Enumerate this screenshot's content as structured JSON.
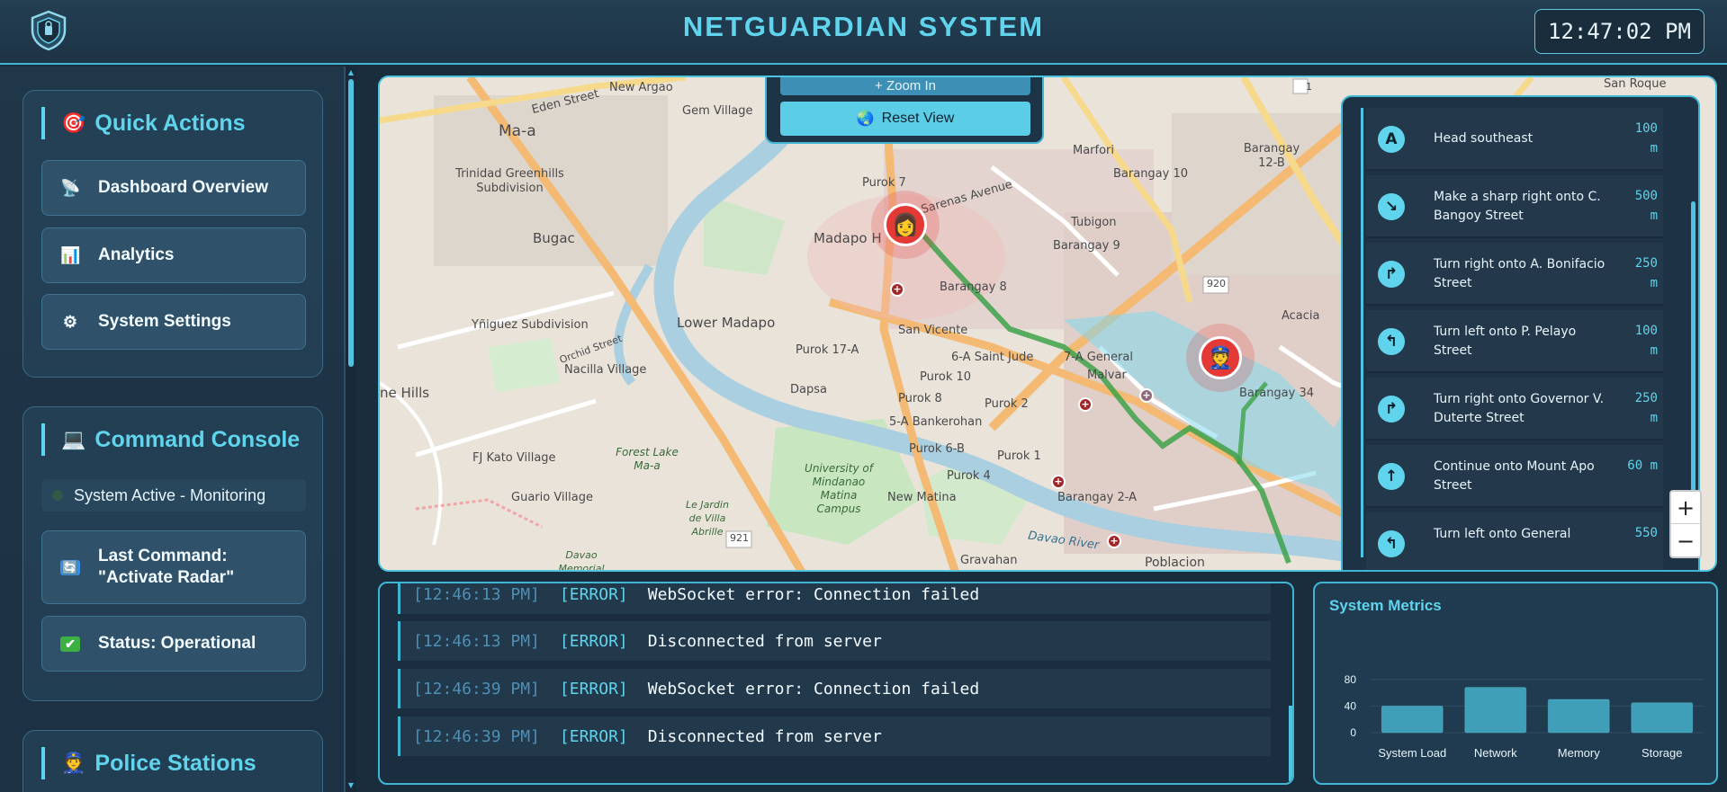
{
  "header": {
    "title": "NETGUARDIAN SYSTEM",
    "time": "12:47:02 PM"
  },
  "sidebar": {
    "quick_actions": {
      "title": "Quick Actions",
      "items": [
        {
          "label": "Dashboard Overview",
          "icon": "satellite-dish-icon"
        },
        {
          "label": "Analytics",
          "icon": "bar-chart-icon"
        },
        {
          "label": "System Settings",
          "icon": "gear-icon"
        }
      ]
    },
    "command_console": {
      "title": "Command Console",
      "status": "System Active - Monitoring",
      "last_command": "Last Command: \"Activate Radar\"",
      "operational": "Status: Operational"
    },
    "police_stations": {
      "title": "Police Stations"
    }
  },
  "map": {
    "zoom_in_label": "+ Zoom In",
    "reset_label": "Reset View",
    "labels": {
      "eden": "Eden Street",
      "new_argao": "New Argao",
      "ma_a": "Ma-a",
      "gem": "Gem Village",
      "trinidad": "Trinidad Greenhills Subdivision",
      "bugac": "Bugac",
      "yniguez": "Yñiguez Subdivision",
      "orchid": "Orchid Street",
      "nacilla": "Nacilla Village",
      "hills": "ne Hills",
      "fj_kato": "FJ Kato Village",
      "guario": "Guario Village",
      "lower_madapo": "Lower Madapo",
      "madapo": "Madapo H",
      "purok7": "Purok 7",
      "sarenas": "Sarenas Avenue",
      "barangay8": "Barangay 8",
      "san_vicente": "San Vicente",
      "purok17a": "Purok 17-A",
      "dapsa": "Dapsa",
      "purok8": "Purok 8",
      "purok10": "Purok 10",
      "saint_jude": "6-A Saint Jude",
      "bankerohan": "5-A Bankerohan",
      "purok6b": "Purok 6-B",
      "purok4": "Purok 4",
      "new_matina": "New Matina",
      "purok2": "Purok 2",
      "purok1": "Purok 1",
      "forest_lake": "Forest Lake Ma-a",
      "university": "University of Mindanao Matina Campus",
      "le_jardin": "Le Jardin de Villa Abrille",
      "davao_memorial": "Davao Memorial",
      "gravahan": "Gravahan",
      "poblacion": "Poblacion",
      "barangay9": "Barangay 9",
      "barangay10": "Barangay 10",
      "barangay12": "Barangay 12-B",
      "barangay34": "Barangay 34",
      "barangay2": "Barangay 2-A",
      "tubigon": "Tubigon",
      "marfori": "Marfori",
      "acacia": "Acacia",
      "malvar": "Malvar",
      "general": "7-A General",
      "san_roque": "San Roque",
      "road921": "921",
      "road920": "920",
      "road1": "1",
      "davao_river": "Davao River"
    }
  },
  "directions": [
    {
      "icon": "A",
      "text": "Head southeast",
      "distance": "100 m"
    },
    {
      "icon": "↘",
      "text": "Make a sharp right onto C. Bangoy Street",
      "distance": "500 m"
    },
    {
      "icon": "↱",
      "text": "Turn right onto A. Bonifacio Street",
      "distance": "250 m"
    },
    {
      "icon": "↰",
      "text": "Turn left onto P. Pelayo Street",
      "distance": "100 m"
    },
    {
      "icon": "↱",
      "text": "Turn right onto Governor V. Duterte Street",
      "distance": "250 m"
    },
    {
      "icon": "↑",
      "text": "Continue onto Mount Apo Street",
      "distance": "60 m"
    },
    {
      "icon": "↰",
      "text": "Turn left onto General",
      "distance": "550"
    }
  ],
  "map_zoom": {
    "plus": "+",
    "minus": "−"
  },
  "console": [
    {
      "time": "[12:46:13 PM]",
      "level": "[ERROR]",
      "message": "WebSocket error: Connection failed"
    },
    {
      "time": "[12:46:13 PM]",
      "level": "[ERROR]",
      "message": "Disconnected from server"
    },
    {
      "time": "[12:46:39 PM]",
      "level": "[ERROR]",
      "message": "WebSocket error: Connection failed"
    },
    {
      "time": "[12:46:39 PM]",
      "level": "[ERROR]",
      "message": "Disconnected from server"
    }
  ],
  "metrics": {
    "title": "System Metrics"
  },
  "chart_data": {
    "type": "bar",
    "title": "",
    "categories": [
      "System Load",
      "Network",
      "Memory",
      "Storage"
    ],
    "values": [
      40,
      68,
      50,
      45
    ],
    "ylim": [
      0,
      100
    ],
    "yticks": [
      0,
      40,
      80
    ],
    "grid": true,
    "color": "#3f9fb8"
  },
  "colors": {
    "accent": "#5fd4ec",
    "background": "#1a2d3d",
    "alert": "#e53935"
  }
}
